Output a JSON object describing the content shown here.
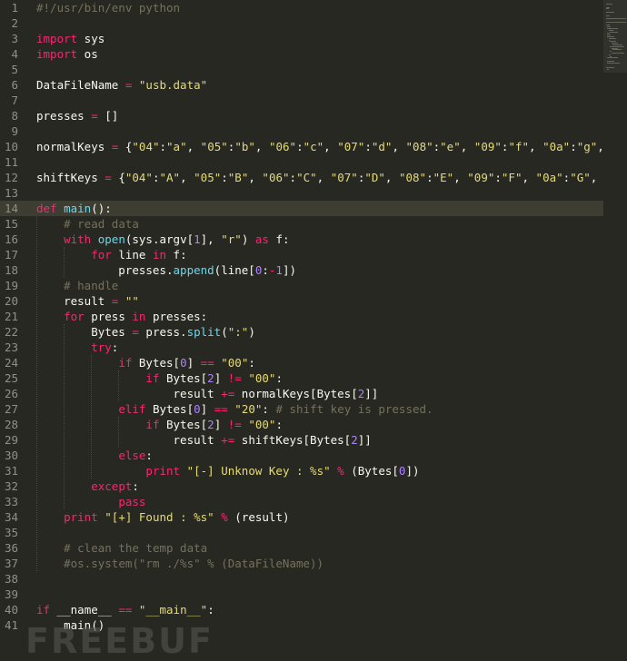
{
  "editor": {
    "theme_colors": {
      "background": "#272822",
      "keyword": "#f92672",
      "string": "#e6db74",
      "number": "#ae81ff",
      "builtin": "#66d9ef",
      "comment": "#75715e",
      "text": "#f8f8f2"
    },
    "current_line": 14,
    "lines": [
      "#!/usr/bin/env python",
      "",
      "import sys",
      "import os",
      "",
      "DataFileName = \"usb.data\"",
      "",
      "presses = []",
      "",
      "normalKeys = {\"04\":\"a\", \"05\":\"b\", \"06\":\"c\", \"07\":\"d\", \"08\":\"e\", \"09\":\"f\", \"0a\":\"g\",",
      "",
      "shiftKeys = {\"04\":\"A\", \"05\":\"B\", \"06\":\"C\", \"07\":\"D\", \"08\":\"E\", \"09\":\"F\", \"0a\":\"G\",",
      "",
      "def main():",
      "    # read data",
      "    with open(sys.argv[1], \"r\") as f:",
      "        for line in f:",
      "            presses.append(line[0:-1])",
      "    # handle",
      "    result = \"\"",
      "    for press in presses:",
      "        Bytes = press.split(\":\")",
      "        try:",
      "            if Bytes[0] == \"00\":",
      "                if Bytes[2] != \"00\":",
      "                    result += normalKeys[Bytes[2]]",
      "            elif Bytes[0] == \"20\": # shift key is pressed.",
      "                if Bytes[2] != \"00\":",
      "                    result += shiftKeys[Bytes[2]]",
      "            else:",
      "                print \"[-] Unknow Key : %s\" % (Bytes[0])",
      "        except:",
      "            pass",
      "    print \"[+] Found : %s\" % (result)",
      "",
      "    # clean the temp data",
      "    #os.system(\"rm ./%s\" % (DataFileName))",
      "",
      "",
      "if __name__ == \"__main__\":",
      "    main()"
    ]
  },
  "watermark": {
    "text": "FREEBUF"
  }
}
